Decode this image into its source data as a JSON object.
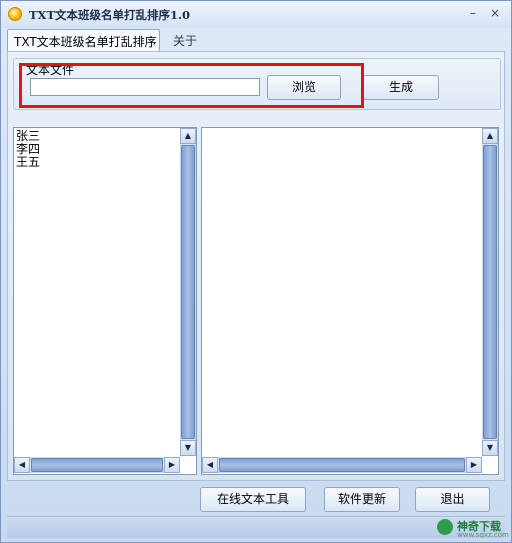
{
  "window": {
    "title": "TXT文本班级名单打乱排序1.0",
    "minimize": "–",
    "close": "×"
  },
  "tabs": [
    {
      "label": "TXT文本班级名单打乱排序",
      "active": true
    },
    {
      "label": "关于",
      "active": false
    }
  ],
  "file_group": {
    "label": "文本文件",
    "input_value": "",
    "browse_label": "浏览",
    "generate_label": "生成"
  },
  "left_list": {
    "items": [
      "张三",
      "李四",
      "王五"
    ]
  },
  "right_list": {
    "items": []
  },
  "bottom_buttons": {
    "online_tools": "在线文本工具",
    "update": "软件更新",
    "exit": "退出"
  },
  "watermark": {
    "name": "神奇下载",
    "sub": "www.sqxz.com"
  },
  "colors": {
    "highlight": "#e0141b",
    "accent": "#7f9fd0"
  }
}
